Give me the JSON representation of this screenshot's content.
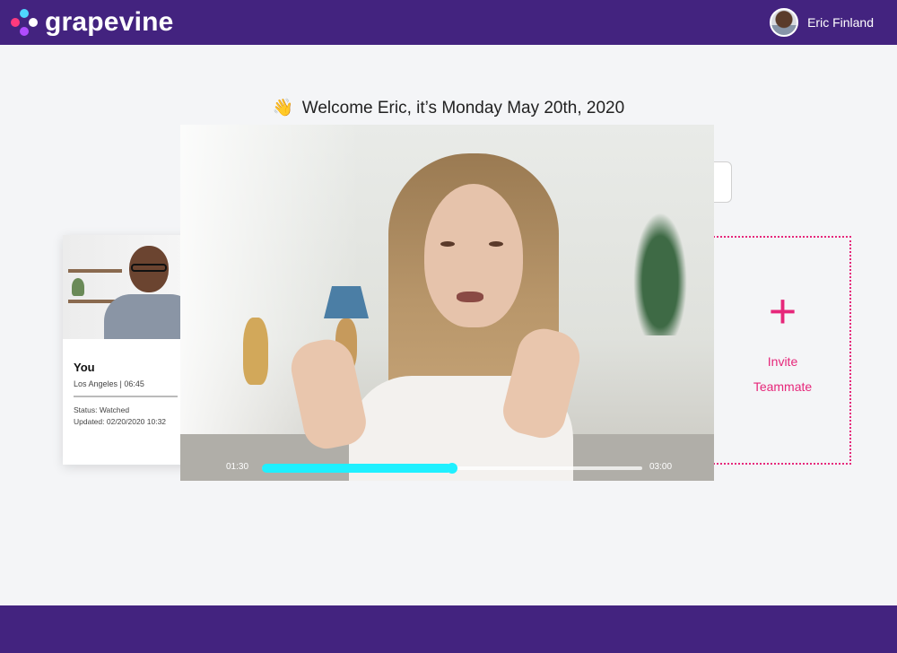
{
  "brand": {
    "name": "grapevine",
    "accent": "#43237f"
  },
  "user": {
    "name": "Eric Finland"
  },
  "welcome": {
    "icon": "waving-hand-icon",
    "text": "Welcome Eric, it’s Monday May 20th, 2020"
  },
  "you_card": {
    "title": "You",
    "location": "Los Angeles | 06:45",
    "status": "Status: Watched",
    "updated": "Updated:   02/20/2020 10:32"
  },
  "invite": {
    "icon": "plus-icon",
    "label_line1": "Invite",
    "label_line2": "Teammate",
    "color": "#e6277a"
  },
  "player": {
    "current_time": "01:30",
    "duration": "03:00",
    "progress": 0.5,
    "progress_color": "#1ff0ff"
  }
}
